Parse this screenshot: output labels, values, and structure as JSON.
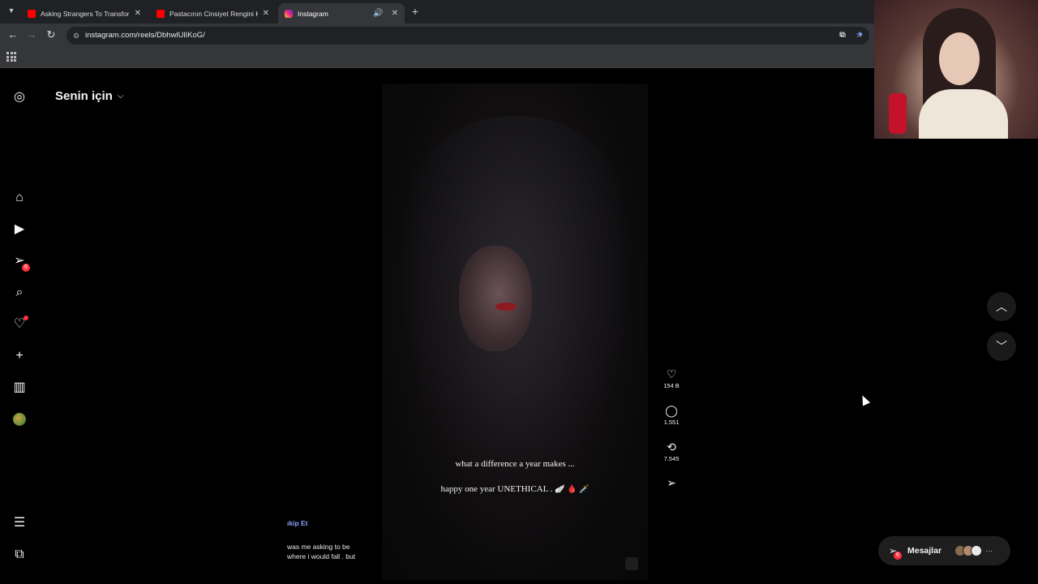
{
  "browser": {
    "tabs": [
      {
        "title": "Asking Strangers To Transform",
        "favicon": "youtube-icon"
      },
      {
        "title": "Pastacının Cinsiyet Rengini Karı",
        "favicon": "youtube-icon"
      },
      {
        "title": "Instagram",
        "favicon": "instagram-icon",
        "active": true
      }
    ],
    "url": "instagram.com/reels/DbhwlUlIKoG/"
  },
  "instagram": {
    "feed_title": "Senin için",
    "notifications_badge": "6",
    "partial_follow": "ıkip Et",
    "partial_caption_1": "was me asking to be",
    "partial_caption_2": "where i would fall . but"
  },
  "reel": {
    "caption_line1": "what a difference a year makes ...",
    "caption_line2": "happy one year UNETHICAL .",
    "caption_emojis": "🪽 🩸 🗡️",
    "likes": "154 B",
    "comments": "1.551",
    "reposts": "7.545"
  },
  "messages": {
    "label": "Mesajlar",
    "badge": "6"
  },
  "colors": {
    "tabbar": "#202124",
    "toolbar": "#35363a",
    "background": "#000000",
    "badge": "#ff3040",
    "accent_link": "#8fa3ff"
  }
}
